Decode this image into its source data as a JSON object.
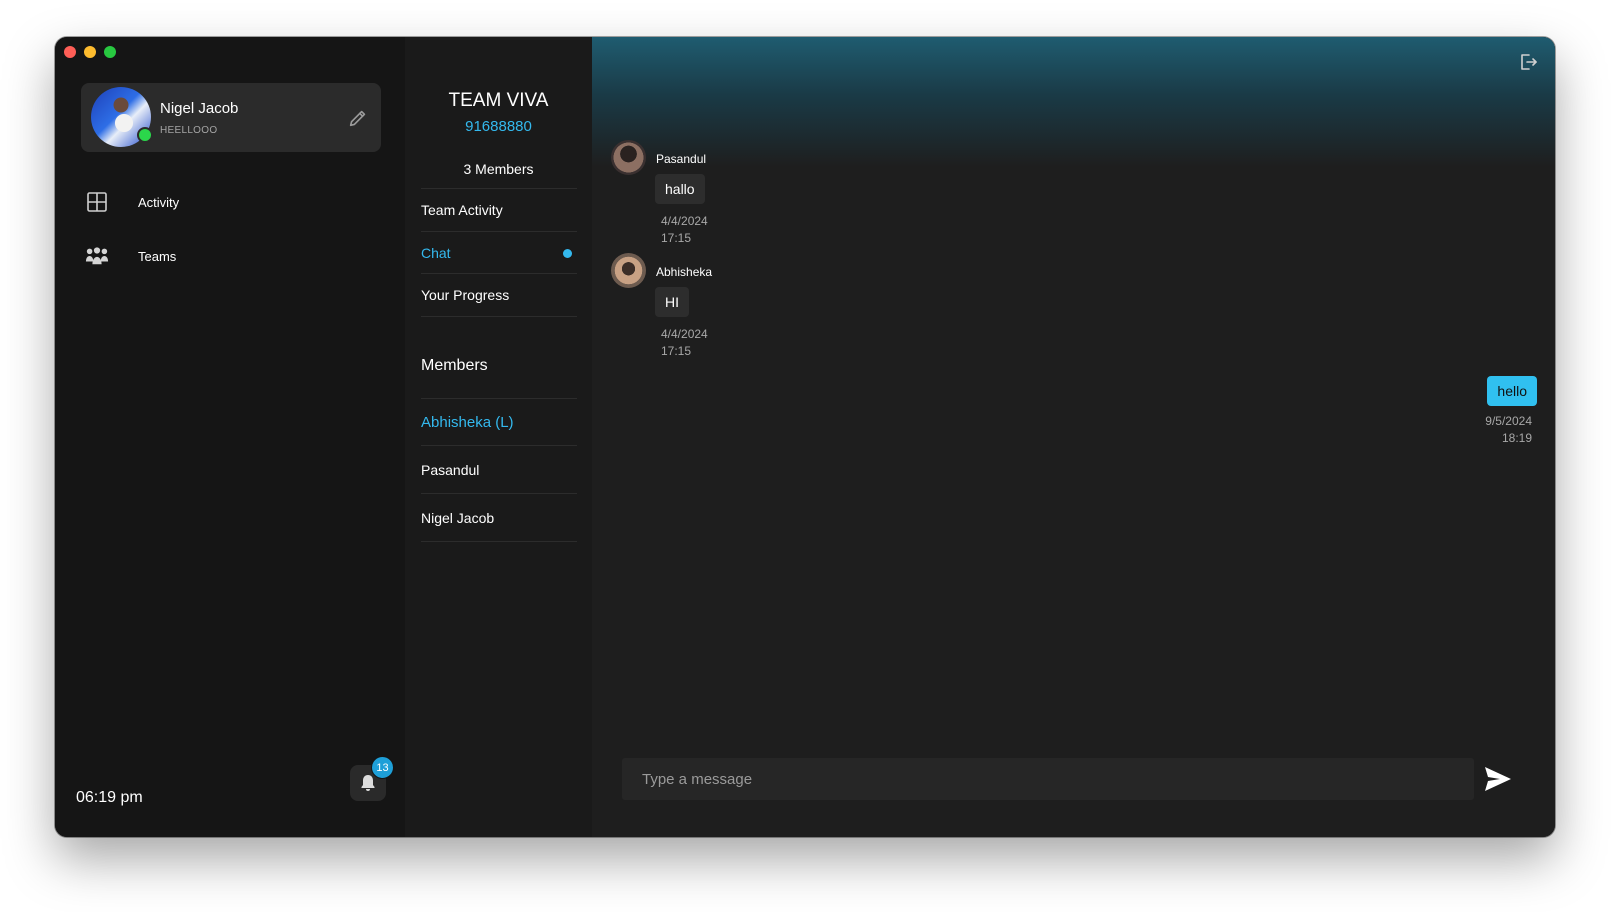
{
  "sidebar": {
    "profile": {
      "name": "Nigel Jacob",
      "status": "HEELLOOO"
    },
    "nav": [
      {
        "label": "Activity",
        "icon": "grid-icon"
      },
      {
        "label": "Teams",
        "icon": "group-icon"
      }
    ],
    "clock": "06:19 pm",
    "notifications": {
      "count": "13",
      "icon": "bell-icon"
    }
  },
  "team": {
    "name": "TEAM VIVA",
    "code": "91688880",
    "member_count": "3 Members",
    "menu": [
      {
        "label": "Team Activity",
        "active": false
      },
      {
        "label": "Chat",
        "active": true
      },
      {
        "label": "Your Progress",
        "active": false
      }
    ],
    "members_title": "Members",
    "members": [
      "Abhisheka (L)",
      "Pasandul",
      "Nigel Jacob"
    ]
  },
  "chat": {
    "messages": [
      {
        "sender": "Pasandul",
        "text": "hallo",
        "date": "4/4/2024",
        "time": "17:15"
      },
      {
        "sender": "Abhisheka",
        "text": "HI",
        "date": "4/4/2024",
        "time": "17:15"
      }
    ],
    "own_message": {
      "text": "hello",
      "date": "9/5/2024",
      "time": "18:19"
    },
    "input_placeholder": "Type a message"
  },
  "colors": {
    "accent": "#34b9ee",
    "online": "#2bd64b",
    "badge": "#1e9fd8"
  }
}
